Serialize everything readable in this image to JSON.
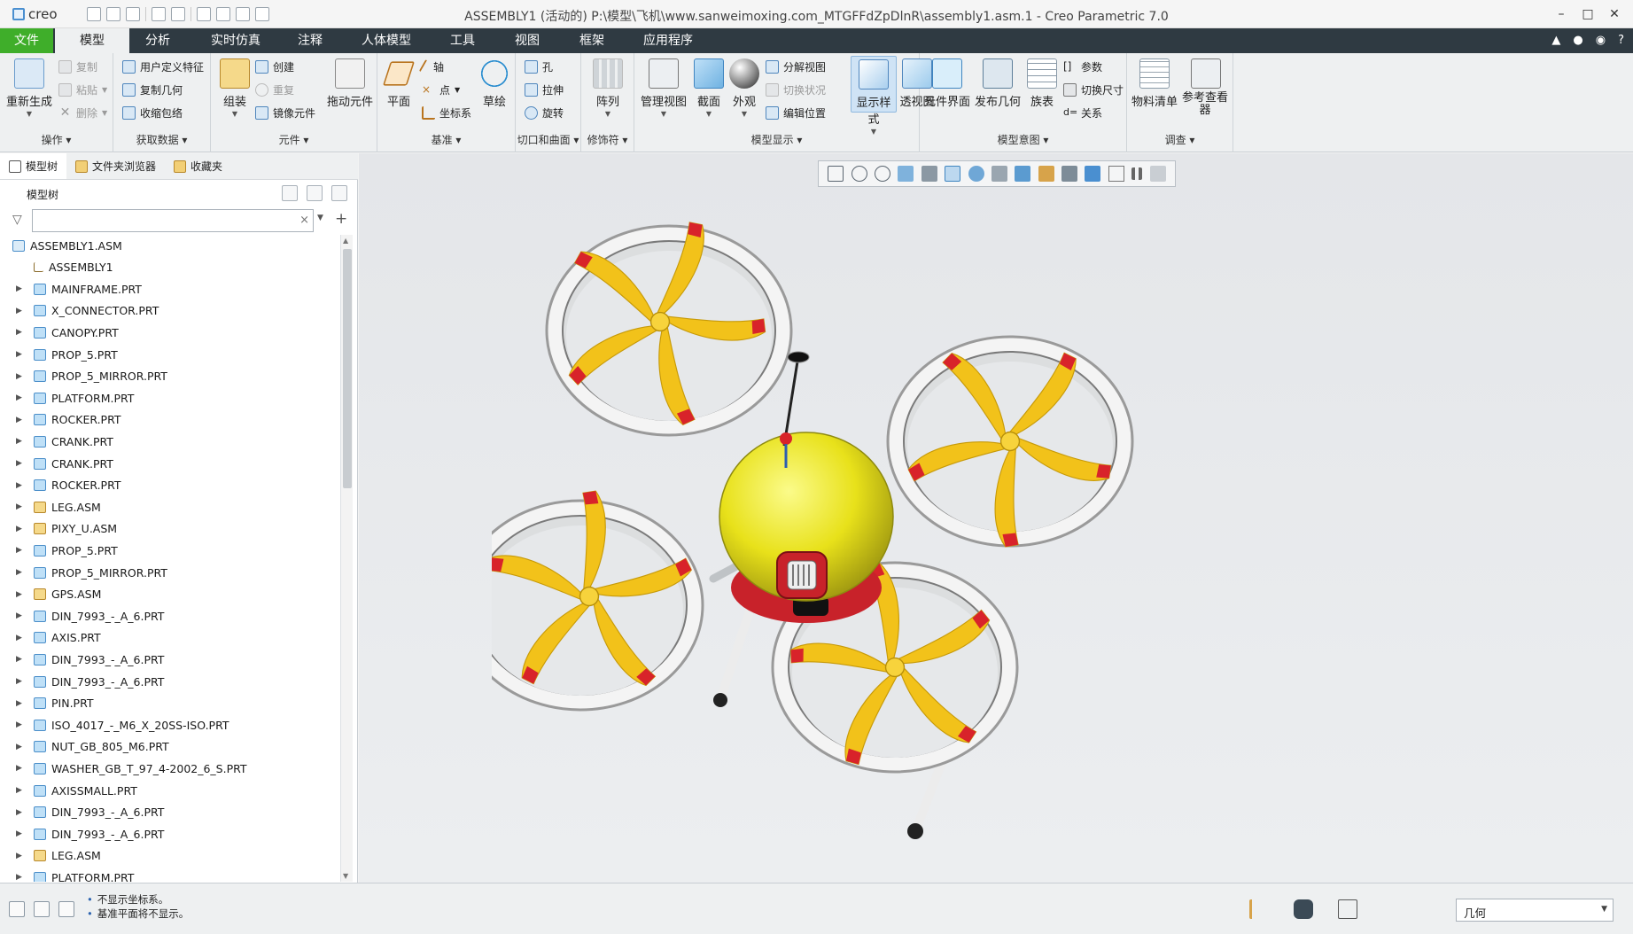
{
  "window": {
    "app_logo": "creo",
    "title": "ASSEMBLY1 (活动的) P:\\模型\\飞机\\www.sanweimoxing.com_MTGFFdZpDlnR\\assembly1.asm.1 - Creo Parametric 7.0",
    "controls": [
      "minimize-icon",
      "maximize-icon",
      "close-icon"
    ]
  },
  "ribbon_tabs": [
    "文件",
    "模型",
    "分析",
    "实时仿真",
    "注释",
    "人体模型",
    "工具",
    "视图",
    "框架",
    "应用程序"
  ],
  "active_tab": "模型",
  "groups": {
    "operations": {
      "label": "操作",
      "regenerate": "重新生成",
      "copy": "复制",
      "paste": "粘贴",
      "delete": "删除"
    },
    "get_data": {
      "label": "获取数据",
      "udf": "用户定义特征",
      "copy_geom": "复制几何",
      "shrinkwrap": "收缩包络"
    },
    "component": {
      "label": "元件",
      "assemble": "组装",
      "create": "创建",
      "repeat": "重复",
      "mirror": "镜像元件",
      "drag": "拖动元件"
    },
    "datum": {
      "label": "基准",
      "plane": "平面",
      "axis": "轴",
      "point": "点",
      "csys": "坐标系",
      "sketch": "草绘"
    },
    "cut_surface": {
      "label": "切口和曲面",
      "hole": "孔",
      "extrude": "拉伸",
      "revolve": "旋转"
    },
    "modifiers": {
      "label": "修饰符",
      "pattern": "阵列"
    },
    "model_display": {
      "label": "模型显示",
      "manage_views": "管理视图",
      "section": "截面",
      "appearance": "外观",
      "explode": "分解视图",
      "toggle_status": "切换状况",
      "edit_position": "编辑位置",
      "display_style": "显示样式",
      "perspective": "透视图"
    },
    "model_intent": {
      "label": "模型意图",
      "component_interface": "元件界面",
      "publish_geom": "发布几何",
      "family_table": "族表",
      "parameters": "参数",
      "switch_dims": "切换尺寸",
      "relations": "关系"
    },
    "investigate": {
      "label": "调查",
      "bom": "物料清单",
      "ref_viewer": "参考查看器"
    }
  },
  "navigator": {
    "tabs": [
      "模型树",
      "文件夹浏览器",
      "收藏夹"
    ],
    "tree_title": "模型树",
    "search_placeholder": "",
    "items": [
      {
        "name": "ASSEMBLY1.ASM",
        "type": "root"
      },
      {
        "name": "ASSEMBLY1",
        "type": "csys"
      },
      {
        "name": "MAINFRAME.PRT",
        "type": "prt"
      },
      {
        "name": "X_CONNECTOR.PRT",
        "type": "prt"
      },
      {
        "name": "CANOPY.PRT",
        "type": "prt"
      },
      {
        "name": "PROP_5.PRT",
        "type": "prt"
      },
      {
        "name": "PROP_5_MIRROR.PRT",
        "type": "prt"
      },
      {
        "name": "PLATFORM.PRT",
        "type": "prt"
      },
      {
        "name": "ROCKER.PRT",
        "type": "prt"
      },
      {
        "name": "CRANK.PRT",
        "type": "prt"
      },
      {
        "name": "CRANK.PRT",
        "type": "prt"
      },
      {
        "name": "ROCKER.PRT",
        "type": "prt"
      },
      {
        "name": "LEG.ASM",
        "type": "asm"
      },
      {
        "name": "PIXY_U.ASM",
        "type": "asm"
      },
      {
        "name": "PROP_5.PRT",
        "type": "prt"
      },
      {
        "name": "PROP_5_MIRROR.PRT",
        "type": "prt"
      },
      {
        "name": "GPS.ASM",
        "type": "asm"
      },
      {
        "name": "DIN_7993_-_A_6.PRT",
        "type": "prt"
      },
      {
        "name": "AXIS.PRT",
        "type": "prt"
      },
      {
        "name": "DIN_7993_-_A_6.PRT",
        "type": "prt"
      },
      {
        "name": "DIN_7993_-_A_6.PRT",
        "type": "prt"
      },
      {
        "name": "PIN.PRT",
        "type": "prt"
      },
      {
        "name": "ISO_4017_-_M6_X_20SS-ISO.PRT",
        "type": "prt"
      },
      {
        "name": "NUT_GB_805_M6.PRT",
        "type": "prt"
      },
      {
        "name": "WASHER_GB_T_97_4-2002_6_S.PRT",
        "type": "prt"
      },
      {
        "name": "AXISSMALL.PRT",
        "type": "prt"
      },
      {
        "name": "DIN_7993_-_A_6.PRT",
        "type": "prt"
      },
      {
        "name": "DIN_7993_-_A_6.PRT",
        "type": "prt"
      },
      {
        "name": "LEG.ASM",
        "type": "asm"
      },
      {
        "name": "PLATFORM.PRT",
        "type": "prt"
      }
    ]
  },
  "status": {
    "messages": [
      "不显示坐标系。",
      "基准平面将不显示。"
    ],
    "selection_filter": "几何"
  },
  "colors": {
    "tabbar": "#2f3a42",
    "file_tab": "#3fae2a",
    "propeller": "#f2c21a",
    "prop_tip": "#d8232a",
    "canopy": "#e8e11a"
  }
}
